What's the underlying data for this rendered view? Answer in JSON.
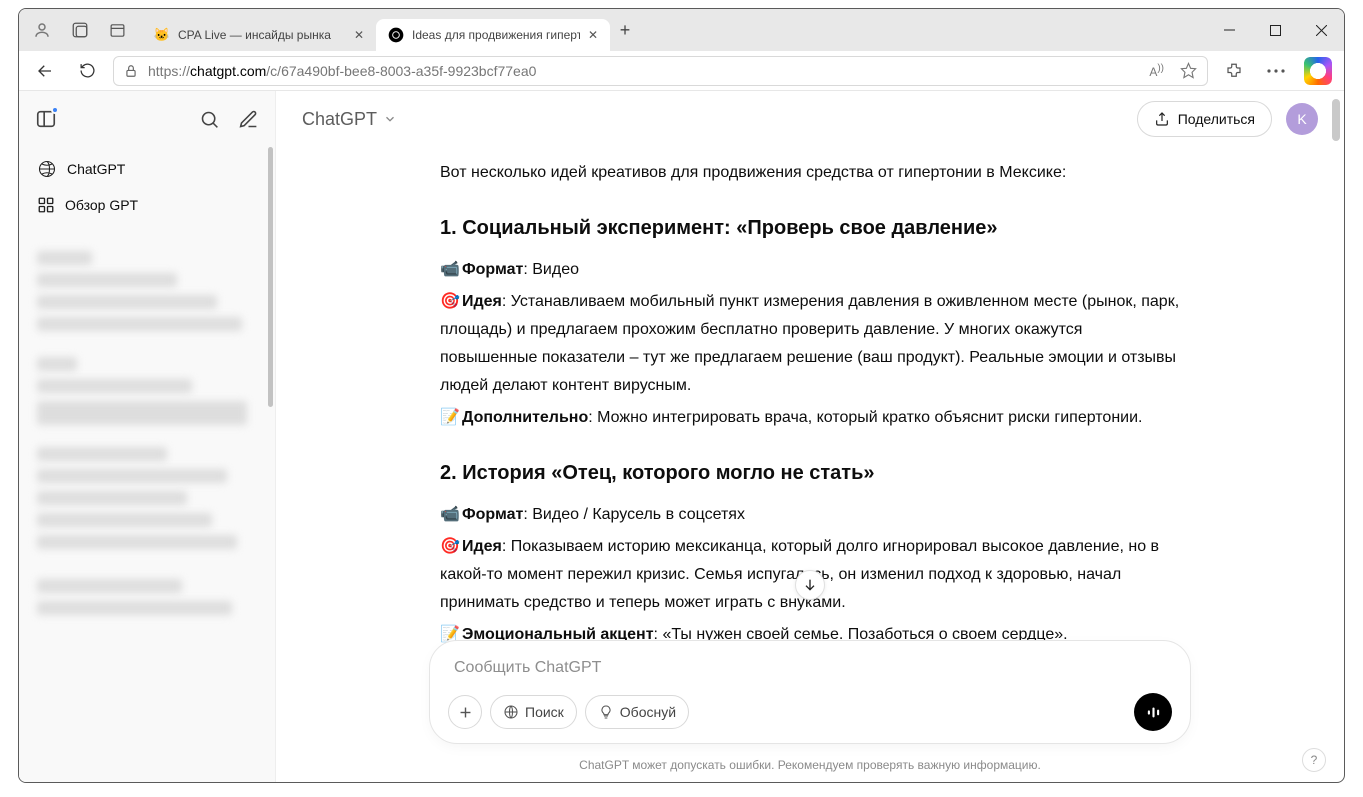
{
  "browser": {
    "tabs": [
      {
        "label": "CPA Live — инсайды рынка"
      },
      {
        "label": "Ideas для продвижения гиперто"
      }
    ],
    "url_proto": "https://",
    "url_host": "chatgpt.com",
    "url_path": "/c/67a490bf-bee8-8003-a35f-9923bcf77ea0"
  },
  "sidebar": {
    "chatgpt_label": "ChatGPT",
    "explore_label": "Обзор GPT"
  },
  "top": {
    "model_label": "ChatGPT",
    "share_label": "Поделиться",
    "avatar_initial": "K"
  },
  "response": {
    "intro": "Вот несколько идей креативов для продвижения средства от гипертонии в Мексике:",
    "h1": "1. Социальный эксперимент: «Проверь свое давление»",
    "s1_l1_lbl": "Формат",
    "s1_l1_val": ": Видео",
    "s1_l2_lbl": "Идея",
    "s1_l2_val": ": Устанавливаем мобильный пункт измерения давления в оживленном месте (рынок, парк, площадь) и предлагаем прохожим бесплатно проверить давление. У многих окажутся повышенные показатели – тут же предлагаем решение (ваш продукт). Реальные эмоции и отзывы людей делают контент вирусным.",
    "s1_l3_lbl": "Дополнительно",
    "s1_l3_val": ": Можно интегрировать врача, который кратко объяснит риски гипертонии.",
    "h2": "2. История «Отец, которого могло не стать»",
    "s2_l1_lbl": "Формат",
    "s2_l1_val": ": Видео / Карусель в соцсетях",
    "s2_l2_lbl": "Идея",
    "s2_l2_val": ": Показываем историю мексиканца, который долго игнорировал высокое давление, но в какой-то момент пережил кризис. Семья испугалась, он изменил подход к здоровью, начал принимать средство и теперь может играть с внуками.",
    "s2_l3_lbl": "Эмоциональный акцент",
    "s2_l3_val": ": «Ты нужен своей семье. Позаботься о своем сердце»."
  },
  "composer": {
    "placeholder": "Сообщить ChatGPT",
    "search_label": "Поиск",
    "reason_label": "Обоснуй"
  },
  "footer": {
    "note": "ChatGPT может допускать ошибки. Рекомендуем проверять важную информацию.",
    "help": "?"
  }
}
